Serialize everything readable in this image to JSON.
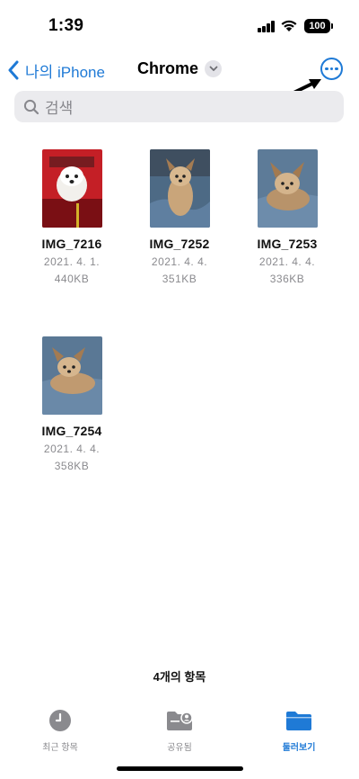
{
  "status_bar": {
    "time": "1:39",
    "battery": "100"
  },
  "nav": {
    "back_label": "나의 iPhone",
    "title": "Chrome",
    "accent_color": "#1f7ad6"
  },
  "search": {
    "placeholder": "검색"
  },
  "files": [
    {
      "name": "IMG_7216",
      "date": "2021. 4. 1.",
      "size": "440KB",
      "thumbnail": "white dog in red car seat"
    },
    {
      "name": "IMG_7252",
      "date": "2021. 4. 4.",
      "size": "351KB",
      "thumbnail": "yorkie standing on blue bed"
    },
    {
      "name": "IMG_7253",
      "date": "2021. 4. 4.",
      "size": "336KB",
      "thumbnail": "yorkie lying on blue bed"
    },
    {
      "name": "IMG_7254",
      "date": "2021. 4. 4.",
      "size": "358KB",
      "thumbnail": "yorkie lying on blue bed"
    }
  ],
  "footer": {
    "item_count": "4개의 항목"
  },
  "tabs": [
    {
      "label": "최근 항목",
      "icon": "clock-icon",
      "active": false
    },
    {
      "label": "공유됨",
      "icon": "shared-folder-icon",
      "active": false
    },
    {
      "label": "둘러보기",
      "icon": "folder-icon",
      "active": true
    }
  ]
}
